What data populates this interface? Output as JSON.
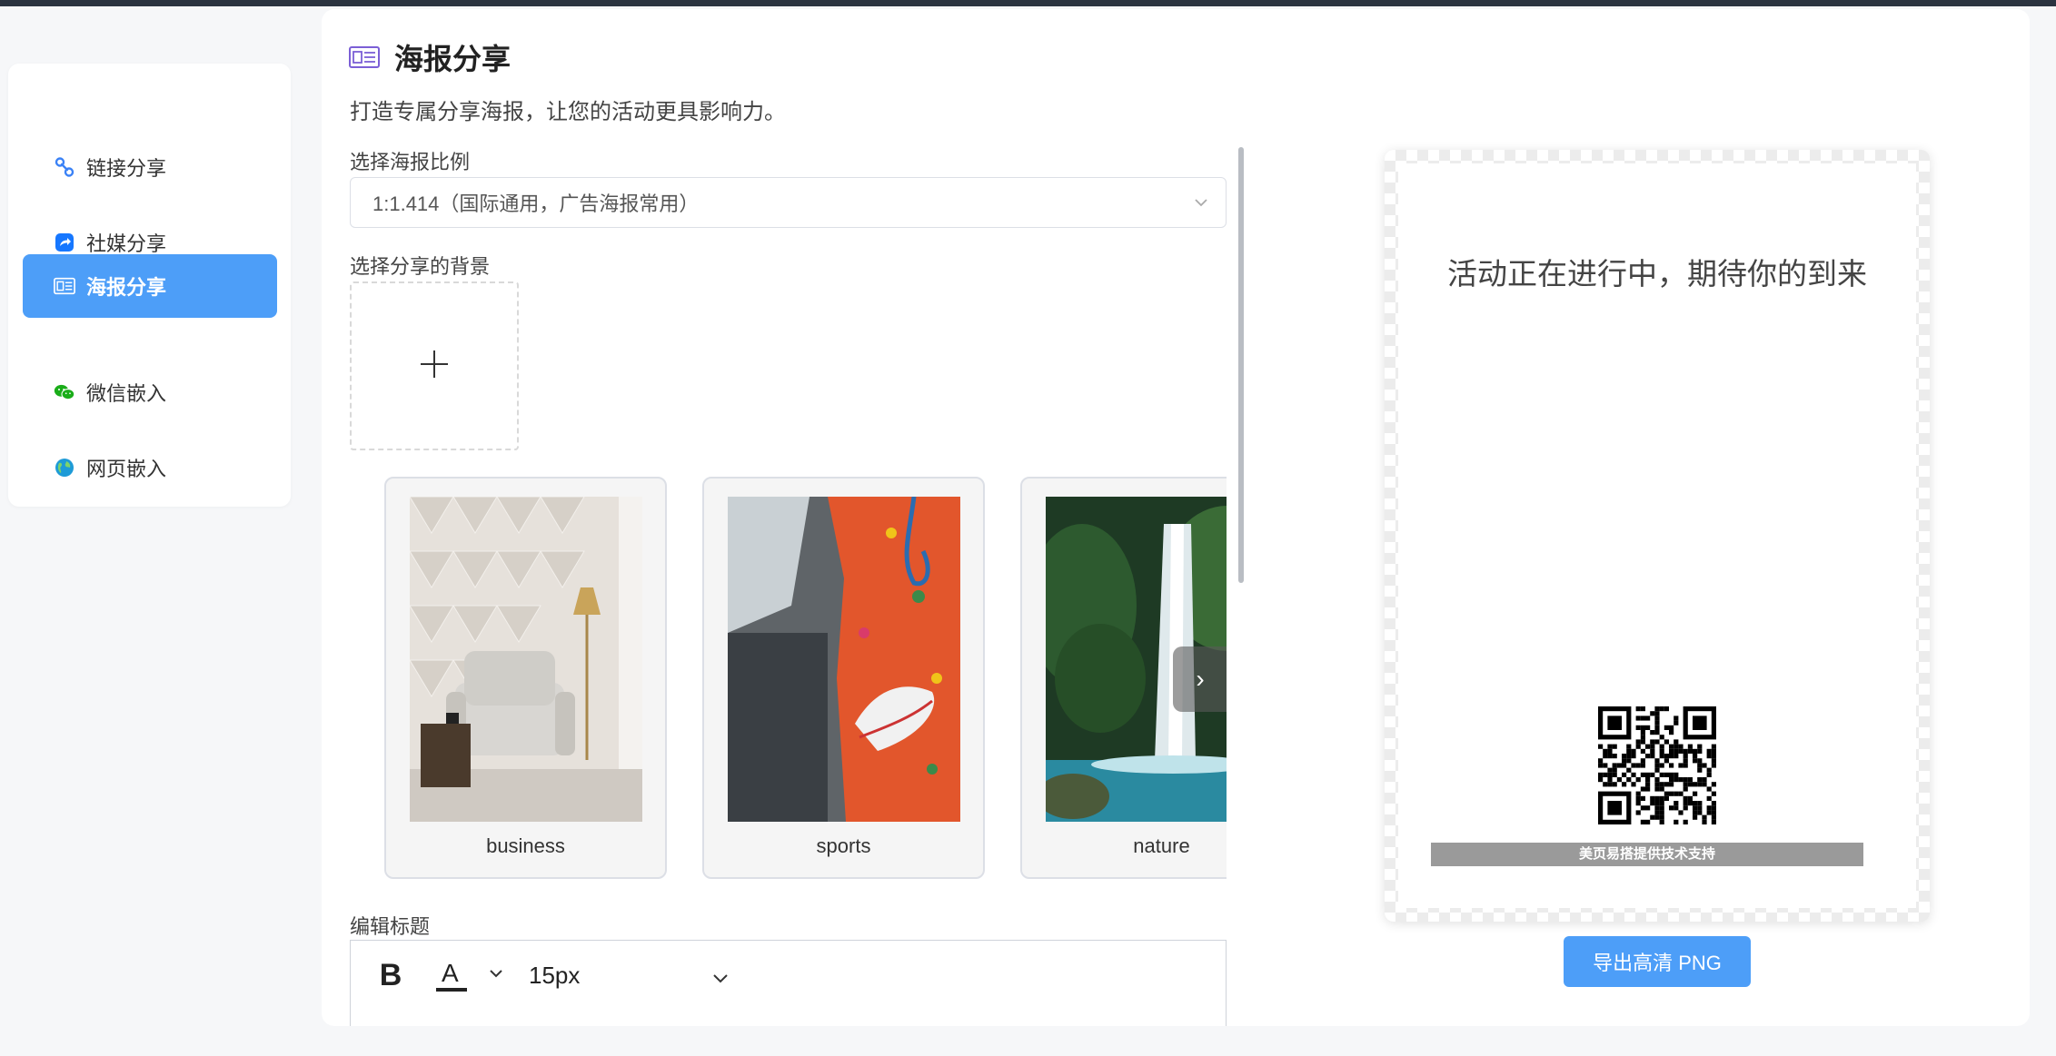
{
  "sidebar": {
    "items": [
      {
        "label": "链接分享",
        "icon": "link-icon"
      },
      {
        "label": "社媒分享",
        "icon": "share-icon"
      },
      {
        "label": "海报分享",
        "icon": "poster-icon"
      },
      {
        "label": "微信嵌入",
        "icon": "wechat-icon"
      },
      {
        "label": "网页嵌入",
        "icon": "globe-icon"
      }
    ],
    "active_index": 2
  },
  "page": {
    "title": "海报分享",
    "subtitle": "打造专属分享海报，让您的活动更具影响力。"
  },
  "ratio": {
    "label": "选择海报比例",
    "value": "1:1.414（国际通用，广告海报常用）"
  },
  "background": {
    "label": "选择分享的背景",
    "cards": [
      {
        "caption": "business"
      },
      {
        "caption": "sports"
      },
      {
        "caption": "nature"
      }
    ]
  },
  "editor": {
    "label": "编辑标题",
    "bold": "B",
    "font_color": "A",
    "font_size": "15px"
  },
  "poster": {
    "title": "活动正在进行中，期待你的到来",
    "footer": "美页易搭提供技术支持"
  },
  "export_label": "导出高清 PNG",
  "colors": {
    "accent": "#4d9ef8",
    "topbar": "#2b3340"
  }
}
